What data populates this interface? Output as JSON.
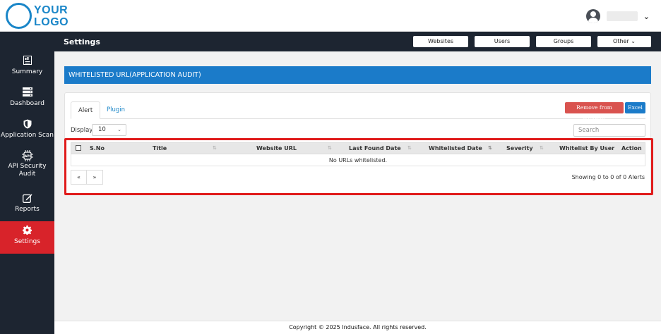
{
  "logo": {
    "line1": "YOUR",
    "line2": "LOGO"
  },
  "header": {
    "user_icon": "user-circle-icon",
    "caret_icon": "chevron-down-icon"
  },
  "subheader": {
    "title": "Settings",
    "buttons": {
      "websites": "Websites",
      "users": "Users",
      "groups": "Groups",
      "other": "Other ⌄"
    }
  },
  "sidebar": {
    "items": [
      {
        "label": "Summary",
        "icon": "summary-report-icon"
      },
      {
        "label": "Dashboard",
        "icon": "dashboard-stack-icon"
      },
      {
        "label": "Application Scan",
        "icon": "shield-icon"
      },
      {
        "label": "API Security Audit",
        "icon": "api-chip-icon"
      },
      {
        "label": "Reports",
        "icon": "edit-report-icon"
      },
      {
        "label": "Settings",
        "icon": "gear-icon",
        "active": true
      }
    ]
  },
  "banner": {
    "title": "WHITELISTED URL(APPLICATION AUDIT)"
  },
  "tabs": {
    "alert": "Alert",
    "plugin": "Plugin"
  },
  "actions": {
    "remove": "Remove from Whitelist",
    "excel": "Excel"
  },
  "controls": {
    "display_label": "Display",
    "display_value": "10",
    "search_placeholder": "Search"
  },
  "table": {
    "columns": [
      "S.No",
      "Title",
      "Website URL",
      "Last Found Date",
      "Whitelisted Date",
      "Severity",
      "Whitelist By User",
      "Action"
    ],
    "empty_message": "No URLs whitelisted."
  },
  "pager": {
    "prev": "«",
    "next": "»"
  },
  "status": {
    "showing": "Showing 0 to 0 of 0 Alerts"
  },
  "footer": {
    "copyright": "Copyright © 2025 Indusface. All rights reserved."
  },
  "colors": {
    "accent_blue": "#1b7bc9",
    "sidebar_bg": "#1d2531",
    "active_red": "#d8232a",
    "highlight_red": "#e01b1b"
  }
}
